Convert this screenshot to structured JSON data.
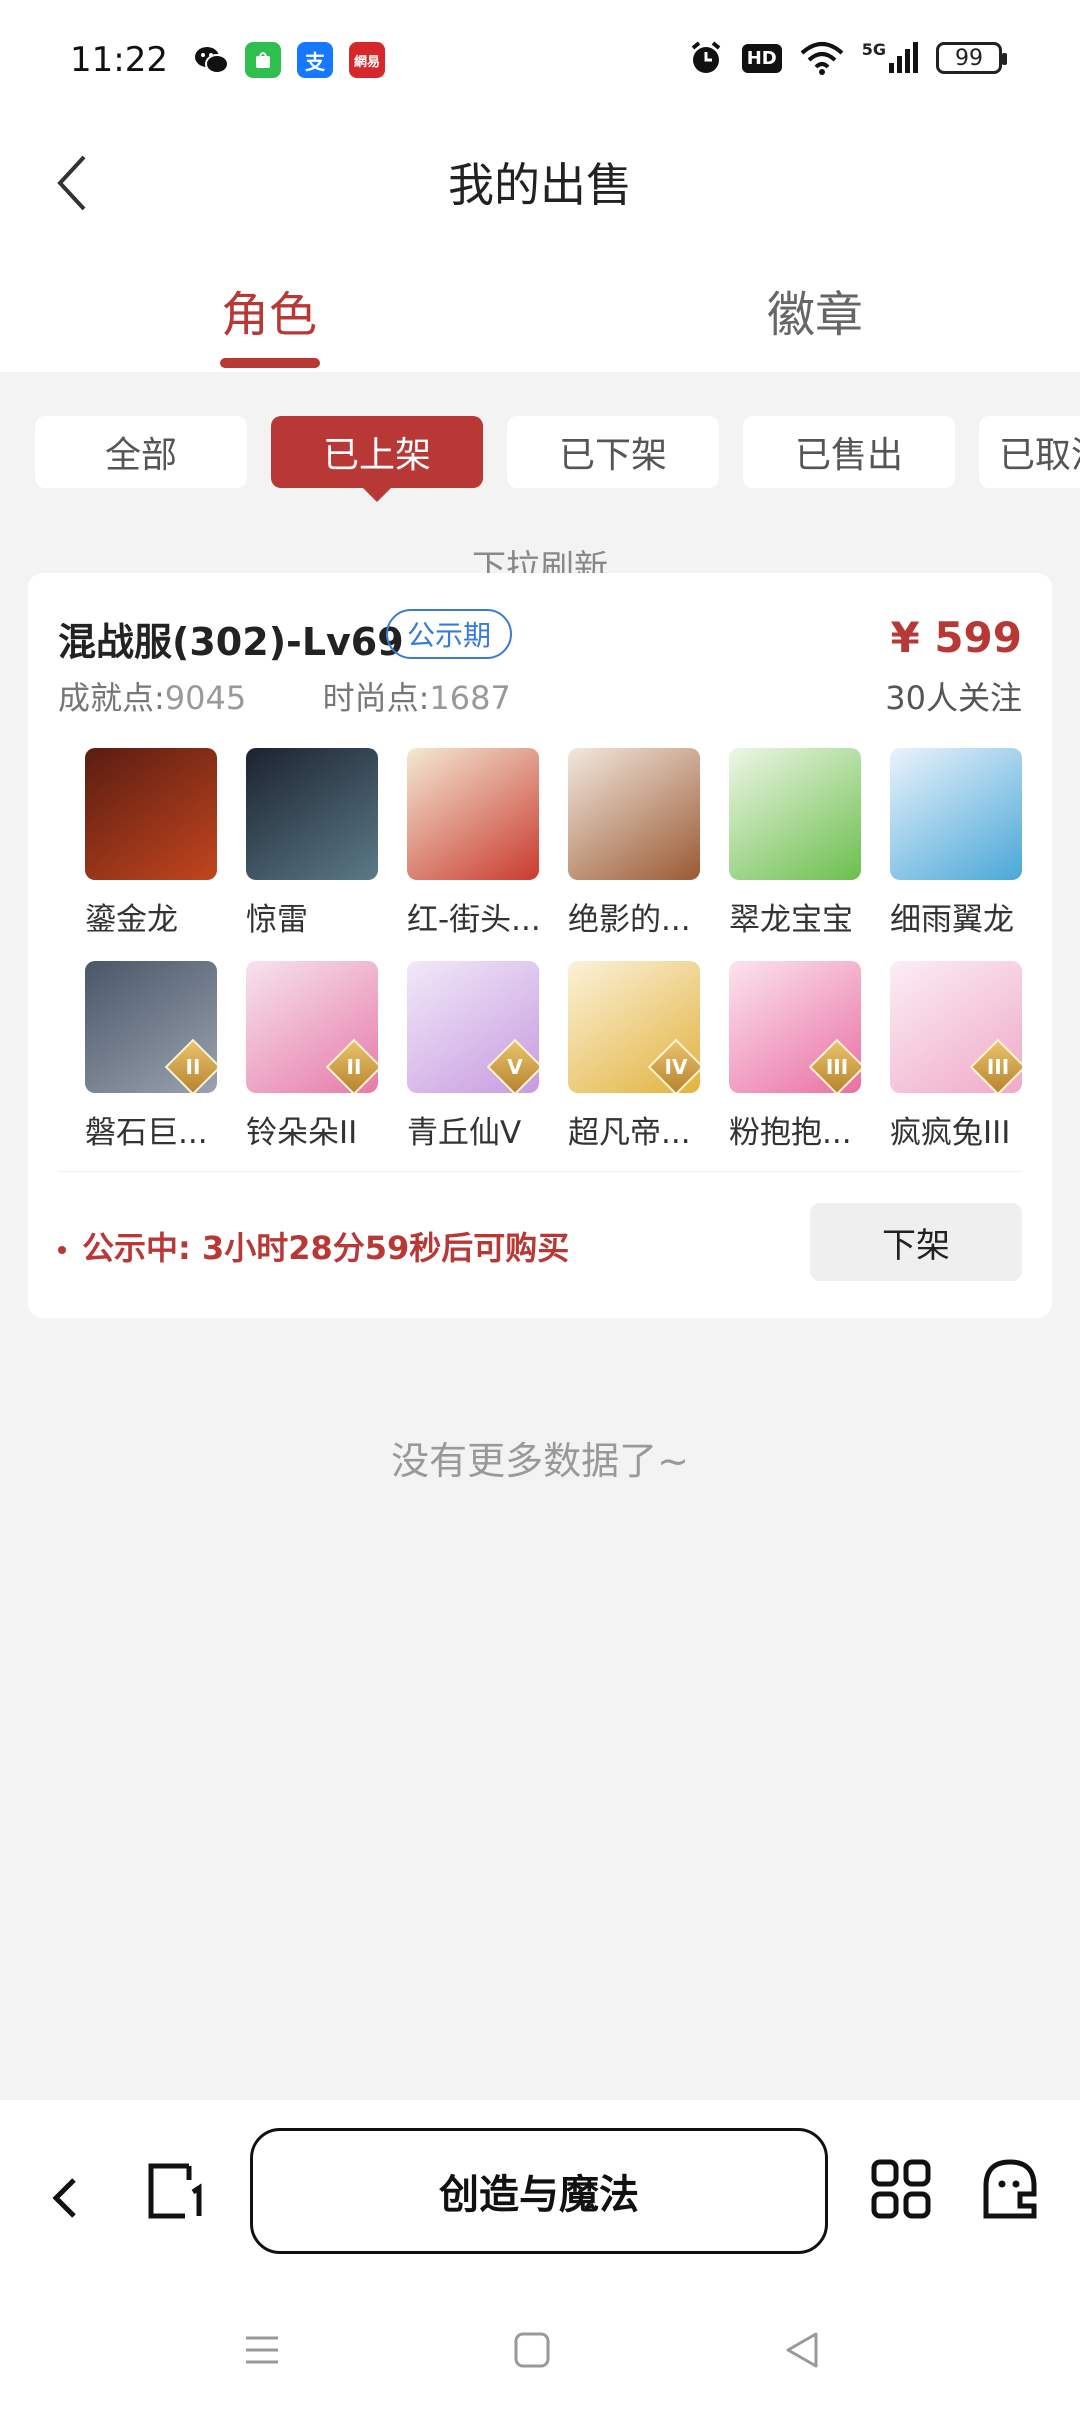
{
  "status_bar": {
    "time": "11:22",
    "apps": [
      {
        "icon": "wechat-icon",
        "glyph": "",
        "color": "#111111"
      },
      {
        "icon": "app-store-icon",
        "glyph": "",
        "color": "#2fbf4f"
      },
      {
        "icon": "alipay-icon",
        "glyph": "支",
        "color": "#1677ff"
      },
      {
        "icon": "netease-icon",
        "glyph": "網易",
        "color": "#d6272a"
      }
    ],
    "network": "5G",
    "hd": "HD",
    "battery": "99"
  },
  "header": {
    "title": "我的出售"
  },
  "tabs": [
    {
      "label": "角色",
      "active": true
    },
    {
      "label": "徽章",
      "active": false
    }
  ],
  "filters": [
    {
      "label": "全部",
      "active": false
    },
    {
      "label": "已上架",
      "active": true
    },
    {
      "label": "已下架",
      "active": false
    },
    {
      "label": "已售出",
      "active": false
    },
    {
      "label": "已取消",
      "active": false
    }
  ],
  "pull_refresh": "下拉刷新",
  "listing": {
    "title": "混战服(302)-Lv69",
    "badge": "公示期",
    "price": "¥ 599",
    "stats": [
      {
        "label": "成就点:",
        "value": "9045"
      },
      {
        "label": "时尚点:",
        "value": "1687"
      }
    ],
    "followers": "30人关注",
    "items": [
      {
        "name": "鎏金龙",
        "tier": "",
        "colors": [
          "#5a1d12",
          "#c2451e"
        ]
      },
      {
        "name": "惊雷",
        "tier": "",
        "colors": [
          "#1c2230",
          "#5b7a86"
        ]
      },
      {
        "name": "红-街头...",
        "tier": "",
        "colors": [
          "#f4e9d4",
          "#c93a2e"
        ]
      },
      {
        "name": "绝影的...",
        "tier": "",
        "colors": [
          "#f2e8de",
          "#9a5a33"
        ]
      },
      {
        "name": "翠龙宝宝",
        "tier": "",
        "colors": [
          "#eef6e6",
          "#6bbf4d"
        ]
      },
      {
        "name": "细雨翼龙",
        "tier": "",
        "colors": [
          "#eaf3fb",
          "#4aa7d8"
        ]
      },
      {
        "name": "磐石巨...",
        "tier": "II",
        "colors": [
          "#4a5668",
          "#9aa3b0"
        ]
      },
      {
        "name": "铃朵朵II",
        "tier": "II",
        "colors": [
          "#f6e3ee",
          "#e77aa8"
        ]
      },
      {
        "name": "青丘仙V",
        "tier": "V",
        "colors": [
          "#f1e9f8",
          "#c79be0"
        ]
      },
      {
        "name": "超凡帝...",
        "tier": "IV",
        "colors": [
          "#fbf2d9",
          "#e2b23f"
        ]
      },
      {
        "name": "粉抱抱...",
        "tier": "III",
        "colors": [
          "#fbe4ee",
          "#ea6fa4"
        ]
      },
      {
        "name": "疯疯兔III",
        "tier": "III",
        "colors": [
          "#fbeef4",
          "#f0a9c8"
        ]
      }
    ],
    "notice_label": "公示中:",
    "notice_time": "3小时28分59秒后可购买",
    "delist_label": "下架"
  },
  "no_more": "没有更多数据了~",
  "bottom_bar": {
    "title": "创造与魔法"
  }
}
